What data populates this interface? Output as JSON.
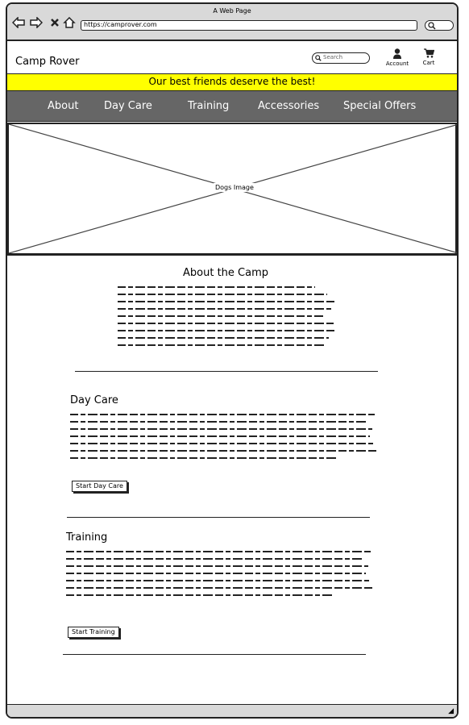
{
  "browser": {
    "title": "A Web Page",
    "url": "https://camprover.com",
    "nav_icons": [
      "back-arrow-icon",
      "forward-arrow-icon",
      "close-icon",
      "home-icon"
    ]
  },
  "header": {
    "brand": "Camp Rover",
    "search_placeholder": "Search",
    "account_label": "Account",
    "cart_label": "Cart"
  },
  "banner": {
    "text": "Our best friends deserve the best!",
    "color": "#ffff00"
  },
  "nav": {
    "items": [
      "About",
      "Day Care",
      "Training",
      "Accessories",
      "Special Offers"
    ],
    "background": "#666666"
  },
  "hero": {
    "label": "Dogs Image"
  },
  "sections": {
    "about": {
      "title": "About the Camp"
    },
    "daycare": {
      "title": "Day Care",
      "button": "Start Day Care"
    },
    "training": {
      "title": "Training",
      "button": "Start Training"
    }
  }
}
